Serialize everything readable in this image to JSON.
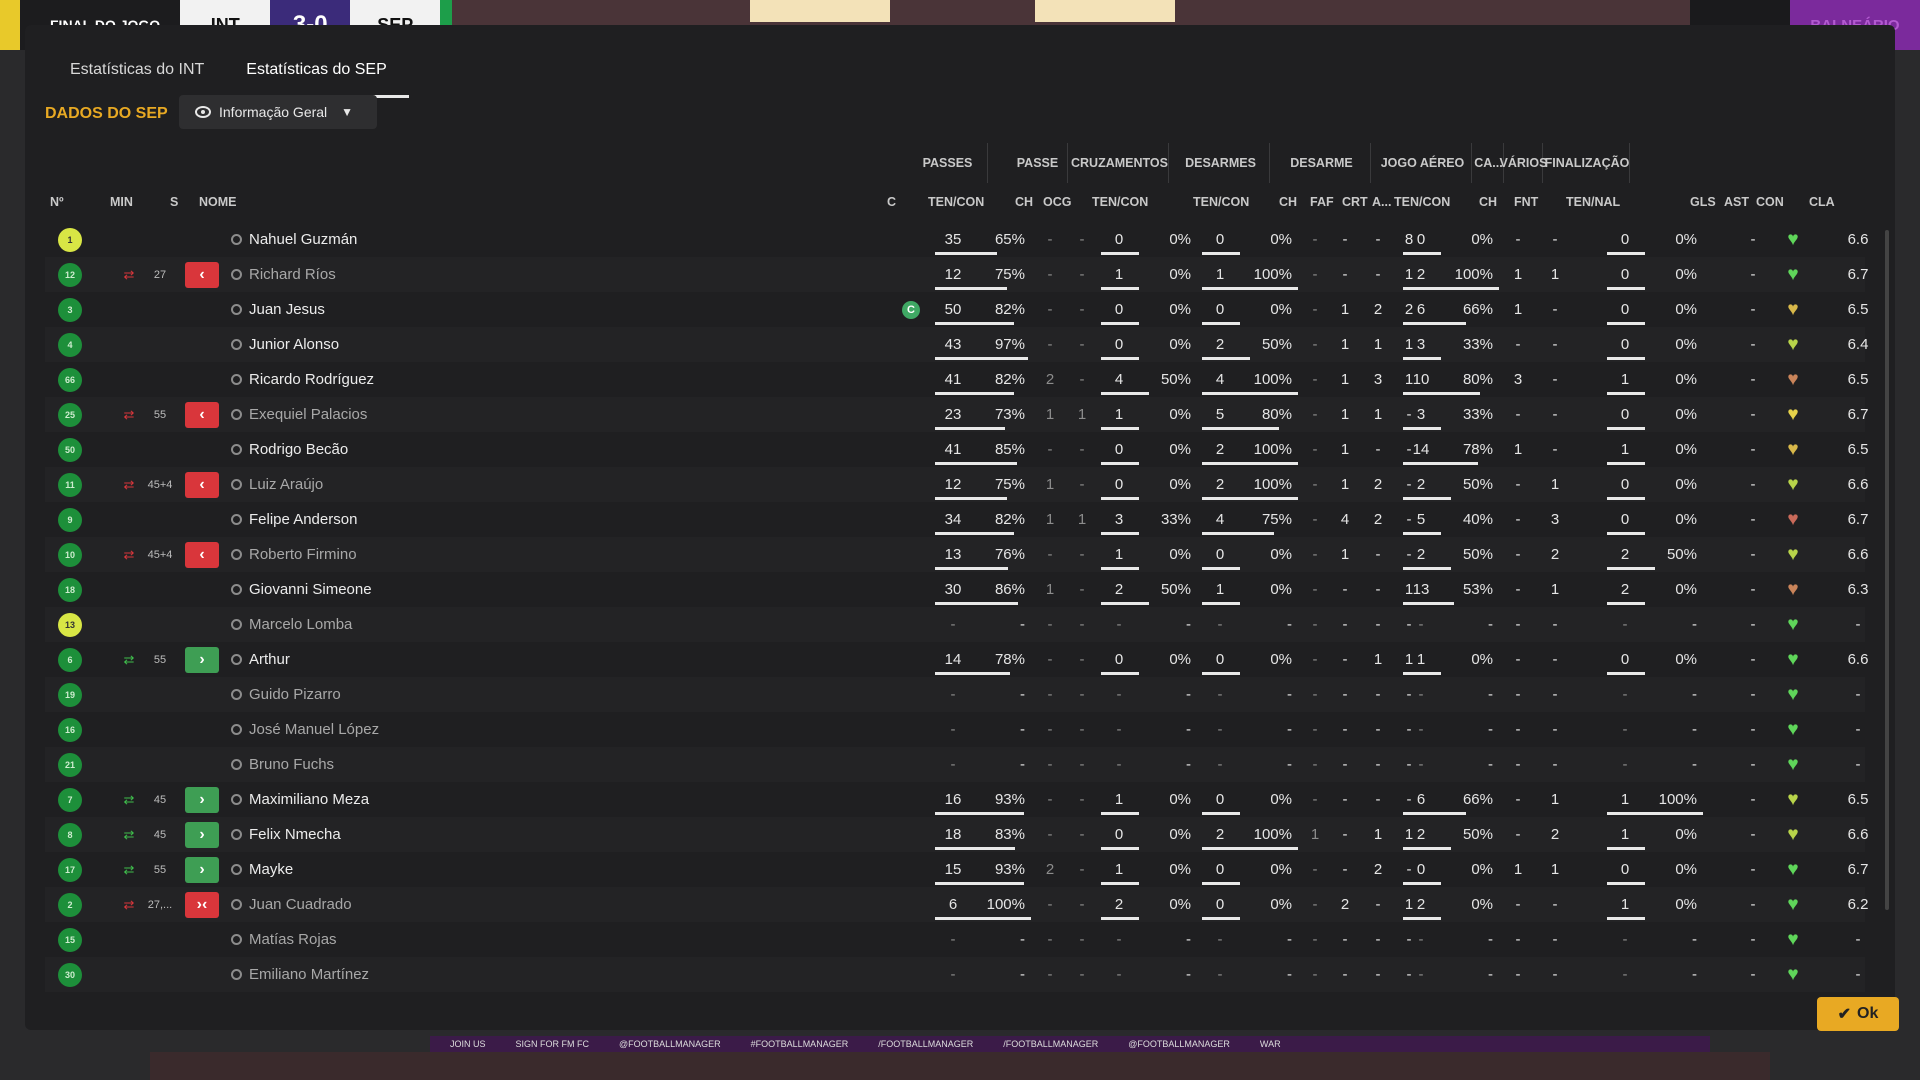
{
  "topbar": {
    "status": "FINAL DO JOGO",
    "home": "INT",
    "score": "3-0",
    "away": "SEP",
    "right_label": "BALNEÁRIO"
  },
  "tabs": [
    {
      "label": "Estatísticas do INT",
      "active": false
    },
    {
      "label": "Estatísticas do SEP",
      "active": true
    }
  ],
  "section_title": "DADOS DO SEP",
  "dropdown_label": "Informação Geral",
  "group_headers": [
    {
      "key": "passes",
      "label": "PASSES"
    },
    {
      "key": "passe",
      "label": "PASSE"
    },
    {
      "key": "cruz",
      "label": "CRUZAMENTOS"
    },
    {
      "key": "desarmes",
      "label": "DESARMES"
    },
    {
      "key": "desarme",
      "label": "DESARME"
    },
    {
      "key": "aereo",
      "label": "JOGO AÉREO"
    },
    {
      "key": "ca",
      "label": "CA..."
    },
    {
      "key": "varios",
      "label": "VÁRIOS"
    },
    {
      "key": "final",
      "label": "FINALIZAÇÃO"
    }
  ],
  "col_headers": {
    "no": "Nº",
    "min": "MIN",
    "s": "S",
    "nome": "NOME",
    "c": "C",
    "passes": "TEN/CON",
    "passe_ch": "CH",
    "passe_ocg": "OCG",
    "cruz": "TEN/CON",
    "desarmes": "TEN/CON",
    "d_ch": "CH",
    "d_faf": "FAF",
    "d_crt": "CRT",
    "d_a": "A...",
    "aereo": "TEN/CON",
    "ca_ch": "CH",
    "fnt": "FNT",
    "final": "TEN/NAL",
    "gls": "GLS",
    "ast": "AST",
    "con": "CON",
    "cla": "CLA"
  },
  "players": [
    {
      "no": "1",
      "gk": true,
      "sub": "",
      "min": "",
      "s": "",
      "name": "Nahuel Guzmán",
      "dim": false,
      "c": "",
      "pt": "35",
      "pp": "65%",
      "pf": 0.65,
      "pch": "-",
      "pocg": "-",
      "ct": "0",
      "cp": "0%",
      "cf": 0,
      "dt": "0",
      "dp": "0%",
      "df": 0,
      "dch": "-",
      "faf": "-",
      "crt": "-",
      "da": "8",
      "at": "0",
      "ap": "0%",
      "af": 0,
      "cach": "-",
      "fnt": "-",
      "ft": "0",
      "fp": "0%",
      "ff": 0,
      "gls": "-",
      "ast": "",
      "con": "#5fd65a",
      "cla": "6.6"
    },
    {
      "no": "12",
      "gk": false,
      "sub": "out",
      "min": "27",
      "s": "out",
      "name": "Richard Ríos",
      "dim": true,
      "c": "",
      "pt": "12",
      "pp": "75%",
      "pf": 0.75,
      "pch": "-",
      "pocg": "-",
      "ct": "1",
      "cp": "0%",
      "cf": 0,
      "dt": "1",
      "dp": "100%",
      "df": 1,
      "dch": "-",
      "faf": "-",
      "crt": "-",
      "da": "1",
      "at": "2",
      "ap": "100%",
      "af": 1,
      "cach": "1",
      "fnt": "1",
      "ft": "0",
      "fp": "0%",
      "ff": 0,
      "gls": "-",
      "ast": "",
      "con": "#5fd65a",
      "cla": "6.7"
    },
    {
      "no": "3",
      "gk": false,
      "sub": "",
      "min": "",
      "s": "",
      "name": "Juan Jesus",
      "dim": false,
      "c": "C",
      "pt": "50",
      "pp": "82%",
      "pf": 0.82,
      "pch": "-",
      "pocg": "-",
      "ct": "0",
      "cp": "0%",
      "cf": 0,
      "dt": "0",
      "dp": "0%",
      "df": 0,
      "dch": "-",
      "faf": "1",
      "crt": "2",
      "da": "2",
      "at": "6",
      "ap": "66%",
      "af": 0.66,
      "cach": "1",
      "fnt": "-",
      "ft": "0",
      "fp": "0%",
      "ff": 0,
      "gls": "-",
      "ast": "",
      "con": "#d8b84a",
      "cla": "6.5"
    },
    {
      "no": "4",
      "gk": false,
      "sub": "",
      "min": "",
      "s": "",
      "name": "Junior Alonso",
      "dim": false,
      "c": "",
      "pt": "43",
      "pp": "97%",
      "pf": 0.97,
      "pch": "-",
      "pocg": "-",
      "ct": "0",
      "cp": "0%",
      "cf": 0,
      "dt": "2",
      "dp": "50%",
      "df": 0.5,
      "dch": "-",
      "faf": "1",
      "crt": "1",
      "da": "1",
      "at": "3",
      "ap": "33%",
      "af": 0.33,
      "cach": "-",
      "fnt": "-",
      "ft": "0",
      "fp": "0%",
      "ff": 0,
      "gls": "-",
      "ast": "",
      "con": "#b8d44a",
      "cla": "6.4"
    },
    {
      "no": "66",
      "gk": false,
      "sub": "",
      "min": "",
      "s": "",
      "name": "Ricardo Rodríguez",
      "dim": false,
      "c": "",
      "pt": "41",
      "pp": "82%",
      "pf": 0.82,
      "pch": "2",
      "pocg": "-",
      "ct": "4",
      "cp": "50%",
      "cf": 0.5,
      "dt": "4",
      "dp": "100%",
      "df": 1,
      "dch": "-",
      "faf": "1",
      "crt": "3",
      "da": "1",
      "at": "10",
      "ap": "80%",
      "af": 0.8,
      "cach": "3",
      "fnt": "-",
      "ft": "1",
      "fp": "0%",
      "ff": 0,
      "gls": "-",
      "ast": "",
      "con": "#c9845a",
      "cla": "6.5"
    },
    {
      "no": "25",
      "gk": false,
      "sub": "out",
      "min": "55",
      "s": "out",
      "name": "Exequiel Palacios",
      "dim": true,
      "c": "",
      "pt": "23",
      "pp": "73%",
      "pf": 0.73,
      "pch": "1",
      "pocg": "1",
      "ct": "1",
      "cp": "0%",
      "cf": 0,
      "dt": "5",
      "dp": "80%",
      "df": 0.8,
      "dch": "-",
      "faf": "1",
      "crt": "1",
      "da": "-",
      "at": "3",
      "ap": "33%",
      "af": 0.33,
      "cach": "-",
      "fnt": "-",
      "ft": "0",
      "fp": "0%",
      "ff": 0,
      "gls": "-",
      "ast": "",
      "con": "#e6d24a",
      "cla": "6.7"
    },
    {
      "no": "50",
      "gk": false,
      "sub": "",
      "min": "",
      "s": "",
      "name": "Rodrigo Becão",
      "dim": false,
      "c": "",
      "pt": "41",
      "pp": "85%",
      "pf": 0.85,
      "pch": "-",
      "pocg": "-",
      "ct": "0",
      "cp": "0%",
      "cf": 0,
      "dt": "2",
      "dp": "100%",
      "df": 1,
      "dch": "-",
      "faf": "1",
      "crt": "-",
      "da": "-",
      "at": "14",
      "ap": "78%",
      "af": 0.78,
      "cach": "1",
      "fnt": "-",
      "ft": "1",
      "fp": "0%",
      "ff": 0,
      "gls": "-",
      "ast": "",
      "con": "#d8b84a",
      "cla": "6.5"
    },
    {
      "no": "11",
      "gk": false,
      "sub": "out",
      "min": "45+4",
      "s": "out",
      "name": "Luiz Araújo",
      "dim": true,
      "c": "",
      "pt": "12",
      "pp": "75%",
      "pf": 0.75,
      "pch": "1",
      "pocg": "-",
      "ct": "0",
      "cp": "0%",
      "cf": 0,
      "dt": "2",
      "dp": "100%",
      "df": 1,
      "dch": "-",
      "faf": "1",
      "crt": "2",
      "da": "-",
      "at": "2",
      "ap": "50%",
      "af": 0.5,
      "cach": "-",
      "fnt": "1",
      "ft": "0",
      "fp": "0%",
      "ff": 0,
      "gls": "-",
      "ast": "",
      "con": "#b8d44a",
      "cla": "6.6"
    },
    {
      "no": "9",
      "gk": false,
      "sub": "",
      "min": "",
      "s": "",
      "name": "Felipe Anderson",
      "dim": false,
      "c": "",
      "pt": "34",
      "pp": "82%",
      "pf": 0.82,
      "pch": "1",
      "pocg": "1",
      "ct": "3",
      "cp": "33%",
      "cf": 0.33,
      "dt": "4",
      "dp": "75%",
      "df": 0.75,
      "dch": "-",
      "faf": "4",
      "crt": "2",
      "da": "-",
      "at": "5",
      "ap": "40%",
      "af": 0.4,
      "cach": "-",
      "fnt": "3",
      "ft": "0",
      "fp": "0%",
      "ff": 0,
      "gls": "-",
      "ast": "",
      "con": "#c96a5a",
      "cla": "6.7"
    },
    {
      "no": "10",
      "gk": false,
      "sub": "out",
      "min": "45+4",
      "s": "out",
      "name": "Roberto Firmino",
      "dim": true,
      "c": "",
      "pt": "13",
      "pp": "76%",
      "pf": 0.76,
      "pch": "-",
      "pocg": "-",
      "ct": "1",
      "cp": "0%",
      "cf": 0,
      "dt": "0",
      "dp": "0%",
      "df": 0,
      "dch": "-",
      "faf": "1",
      "crt": "-",
      "da": "-",
      "at": "2",
      "ap": "50%",
      "af": 0.5,
      "cach": "-",
      "fnt": "2",
      "ft": "2",
      "fp": "50%",
      "ff": 0.5,
      "gls": "-",
      "ast": "",
      "con": "#b8d44a",
      "cla": "6.6"
    },
    {
      "no": "18",
      "gk": false,
      "sub": "",
      "min": "",
      "s": "",
      "name": "Giovanni Simeone",
      "dim": false,
      "c": "",
      "pt": "30",
      "pp": "86%",
      "pf": 0.86,
      "pch": "1",
      "pocg": "-",
      "ct": "2",
      "cp": "50%",
      "cf": 0.5,
      "dt": "1",
      "dp": "0%",
      "df": 0,
      "dch": "-",
      "faf": "-",
      "crt": "-",
      "da": "1",
      "at": "13",
      "ap": "53%",
      "af": 0.53,
      "cach": "-",
      "fnt": "1",
      "ft": "2",
      "fp": "0%",
      "ff": 0,
      "gls": "-",
      "ast": "",
      "con": "#c9845a",
      "cla": "6.3"
    },
    {
      "no": "13",
      "gk": true,
      "sub": "",
      "min": "",
      "s": "",
      "name": "Marcelo Lomba",
      "dim": true,
      "c": "",
      "pt": "-",
      "pp": "-",
      "pf": 0,
      "pch": "-",
      "pocg": "-",
      "ct": "-",
      "cp": "-",
      "cf": 0,
      "dt": "-",
      "dp": "-",
      "df": 0,
      "dch": "-",
      "faf": "-",
      "crt": "-",
      "da": "-",
      "at": "-",
      "ap": "-",
      "af": 0,
      "cach": "-",
      "fnt": "-",
      "ft": "-",
      "fp": "-",
      "ff": 0,
      "gls": "-",
      "ast": "",
      "con": "#5fd65a",
      "cla": "-"
    },
    {
      "no": "6",
      "gk": false,
      "sub": "in",
      "min": "55",
      "s": "in",
      "name": "Arthur",
      "dim": false,
      "c": "",
      "pt": "14",
      "pp": "78%",
      "pf": 0.78,
      "pch": "-",
      "pocg": "-",
      "ct": "0",
      "cp": "0%",
      "cf": 0,
      "dt": "0",
      "dp": "0%",
      "df": 0,
      "dch": "-",
      "faf": "-",
      "crt": "1",
      "da": "1",
      "at": "1",
      "ap": "0%",
      "af": 0,
      "cach": "-",
      "fnt": "-",
      "ft": "0",
      "fp": "0%",
      "ff": 0,
      "gls": "-",
      "ast": "",
      "con": "#5fd65a",
      "cla": "6.6"
    },
    {
      "no": "19",
      "gk": false,
      "sub": "",
      "min": "",
      "s": "",
      "name": "Guido Pizarro",
      "dim": true,
      "c": "",
      "pt": "-",
      "pp": "-",
      "pf": 0,
      "pch": "-",
      "pocg": "-",
      "ct": "-",
      "cp": "-",
      "cf": 0,
      "dt": "-",
      "dp": "-",
      "df": 0,
      "dch": "-",
      "faf": "-",
      "crt": "-",
      "da": "-",
      "at": "-",
      "ap": "-",
      "af": 0,
      "cach": "-",
      "fnt": "-",
      "ft": "-",
      "fp": "-",
      "ff": 0,
      "gls": "-",
      "ast": "",
      "con": "#5fd65a",
      "cla": "-"
    },
    {
      "no": "16",
      "gk": false,
      "sub": "",
      "min": "",
      "s": "",
      "name": "José Manuel López",
      "dim": true,
      "c": "",
      "pt": "-",
      "pp": "-",
      "pf": 0,
      "pch": "-",
      "pocg": "-",
      "ct": "-",
      "cp": "-",
      "cf": 0,
      "dt": "-",
      "dp": "-",
      "df": 0,
      "dch": "-",
      "faf": "-",
      "crt": "-",
      "da": "-",
      "at": "-",
      "ap": "-",
      "af": 0,
      "cach": "-",
      "fnt": "-",
      "ft": "-",
      "fp": "-",
      "ff": 0,
      "gls": "-",
      "ast": "",
      "con": "#5fd65a",
      "cla": "-"
    },
    {
      "no": "21",
      "gk": false,
      "sub": "",
      "min": "",
      "s": "",
      "name": "Bruno Fuchs",
      "dim": true,
      "c": "",
      "pt": "-",
      "pp": "-",
      "pf": 0,
      "pch": "-",
      "pocg": "-",
      "ct": "-",
      "cp": "-",
      "cf": 0,
      "dt": "-",
      "dp": "-",
      "df": 0,
      "dch": "-",
      "faf": "-",
      "crt": "-",
      "da": "-",
      "at": "-",
      "ap": "-",
      "af": 0,
      "cach": "-",
      "fnt": "-",
      "ft": "-",
      "fp": "-",
      "ff": 0,
      "gls": "-",
      "ast": "",
      "con": "#5fd65a",
      "cla": "-"
    },
    {
      "no": "7",
      "gk": false,
      "sub": "in",
      "min": "45",
      "s": "in",
      "name": "Maximiliano Meza",
      "dim": false,
      "c": "",
      "pt": "16",
      "pp": "93%",
      "pf": 0.93,
      "pch": "-",
      "pocg": "-",
      "ct": "1",
      "cp": "0%",
      "cf": 0,
      "dt": "0",
      "dp": "0%",
      "df": 0,
      "dch": "-",
      "faf": "-",
      "crt": "-",
      "da": "-",
      "at": "6",
      "ap": "66%",
      "af": 0.66,
      "cach": "-",
      "fnt": "1",
      "ft": "1",
      "fp": "100%",
      "ff": 1,
      "gls": "-",
      "ast": "",
      "con": "#b8d44a",
      "cla": "6.5"
    },
    {
      "no": "8",
      "gk": false,
      "sub": "in",
      "min": "45",
      "s": "in",
      "name": "Felix Nmecha",
      "dim": false,
      "c": "",
      "pt": "18",
      "pp": "83%",
      "pf": 0.83,
      "pch": "-",
      "pocg": "-",
      "ct": "0",
      "cp": "0%",
      "cf": 0,
      "dt": "2",
      "dp": "100%",
      "df": 1,
      "dch": "1",
      "faf": "-",
      "crt": "1",
      "da": "1",
      "at": "2",
      "ap": "50%",
      "af": 0.5,
      "cach": "-",
      "fnt": "2",
      "ft": "1",
      "fp": "0%",
      "ff": 0,
      "gls": "-",
      "ast": "",
      "con": "#b8d44a",
      "cla": "6.6"
    },
    {
      "no": "17",
      "gk": false,
      "sub": "in",
      "min": "55",
      "s": "in",
      "name": "Mayke",
      "dim": false,
      "c": "",
      "pt": "15",
      "pp": "93%",
      "pf": 0.93,
      "pch": "2",
      "pocg": "-",
      "ct": "1",
      "cp": "0%",
      "cf": 0,
      "dt": "0",
      "dp": "0%",
      "df": 0,
      "dch": "-",
      "faf": "-",
      "crt": "2",
      "da": "-",
      "at": "0",
      "ap": "0%",
      "af": 0,
      "cach": "1",
      "fnt": "1",
      "ft": "0",
      "fp": "0%",
      "ff": 0,
      "gls": "-",
      "ast": "",
      "con": "#5fd65a",
      "cla": "6.7"
    },
    {
      "no": "2",
      "gk": false,
      "sub": "out",
      "min": "27,...",
      "s": "both",
      "name": "Juan Cuadrado",
      "dim": true,
      "c": "",
      "pt": "6",
      "pp": "100%",
      "pf": 1,
      "pch": "-",
      "pocg": "-",
      "ct": "2",
      "cp": "0%",
      "cf": 0,
      "dt": "0",
      "dp": "0%",
      "df": 0,
      "dch": "-",
      "faf": "2",
      "crt": "-",
      "da": "1",
      "at": "2",
      "ap": "0%",
      "af": 0,
      "cach": "-",
      "fnt": "-",
      "ft": "1",
      "fp": "0%",
      "ff": 0,
      "gls": "-",
      "ast": "",
      "con": "#5fd65a",
      "cla": "6.2"
    },
    {
      "no": "15",
      "gk": false,
      "sub": "",
      "min": "",
      "s": "",
      "name": "Matías Rojas",
      "dim": true,
      "c": "",
      "pt": "-",
      "pp": "-",
      "pf": 0,
      "pch": "-",
      "pocg": "-",
      "ct": "-",
      "cp": "-",
      "cf": 0,
      "dt": "-",
      "dp": "-",
      "df": 0,
      "dch": "-",
      "faf": "-",
      "crt": "-",
      "da": "-",
      "at": "-",
      "ap": "-",
      "af": 0,
      "cach": "-",
      "fnt": "-",
      "ft": "-",
      "fp": "-",
      "ff": 0,
      "gls": "-",
      "ast": "",
      "con": "#5fd65a",
      "cla": "-"
    },
    {
      "no": "30",
      "gk": false,
      "sub": "",
      "min": "",
      "s": "",
      "name": "Emiliano Martínez",
      "dim": true,
      "c": "",
      "pt": "-",
      "pp": "-",
      "pf": 0,
      "pch": "-",
      "pocg": "-",
      "ct": "-",
      "cp": "-",
      "cf": 0,
      "dt": "-",
      "dp": "-",
      "df": 0,
      "dch": "-",
      "faf": "-",
      "crt": "-",
      "da": "-",
      "at": "-",
      "ap": "-",
      "af": 0,
      "cach": "-",
      "fnt": "-",
      "ft": "-",
      "fp": "-",
      "ff": 0,
      "gls": "-",
      "ast": "",
      "con": "#5fd65a",
      "cla": "-"
    }
  ],
  "ok_label": "Ok",
  "banner_items": [
    "JOIN US",
    "SIGN FOR FM FC",
    "@FOOTBALLMANAGER",
    "#FOOTBALLMANAGER",
    "/FOOTBALLMANAGER",
    "/FOOTBALLMANAGER",
    "@FOOTBALLMANAGER",
    "WAR"
  ]
}
